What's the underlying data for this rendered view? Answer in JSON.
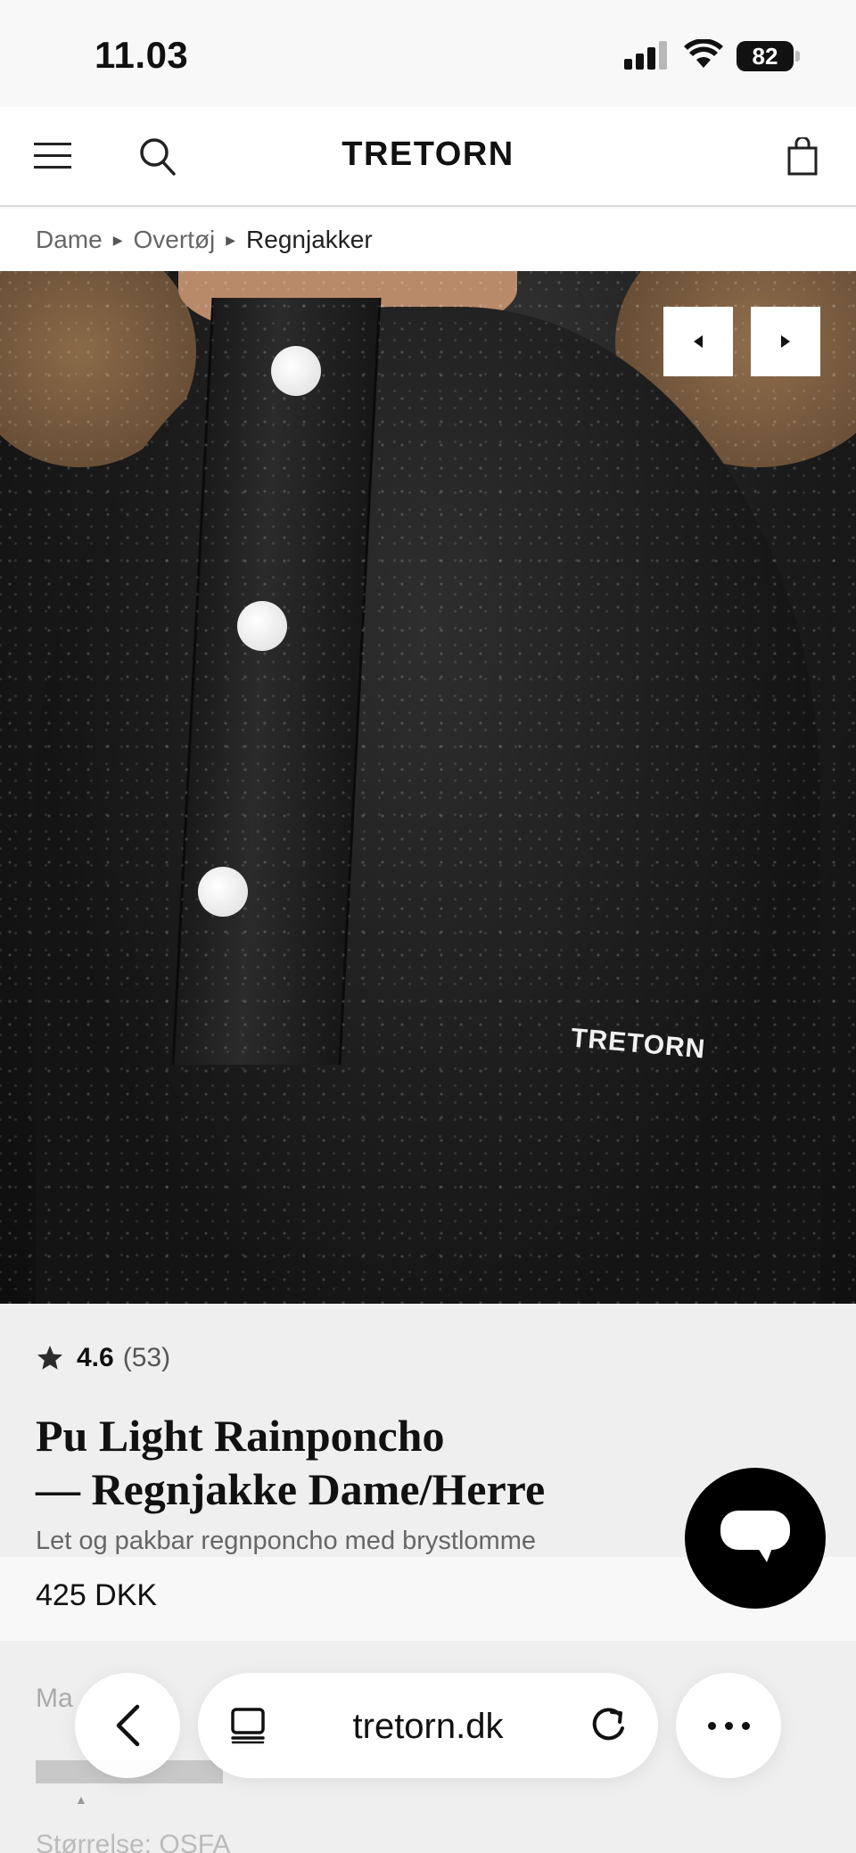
{
  "status_bar": {
    "time": "11.03",
    "battery": "82"
  },
  "header": {
    "logo": "TRETORN"
  },
  "breadcrumb": [
    "Dame",
    "Overtøj",
    "Regnjakker"
  ],
  "hero": {
    "print_logo": "TRETORN"
  },
  "product": {
    "rating_value": "4.6",
    "rating_count": "(53)",
    "title_line1": "Pu Light Rainponcho",
    "title_line2": "— Regnjakke Dame/Herre",
    "subtitle": "Let og pakbar regnponcho med brystlomme",
    "price": "425 DKK",
    "color_label": "Ma",
    "size_label": "Størrelse: OSFA"
  },
  "browser": {
    "url": "tretorn.dk"
  },
  "colors": {
    "accent": "#000000",
    "background": "#efefef"
  },
  "icons": [
    "menu-icon",
    "search-icon",
    "bag-icon",
    "star-icon",
    "chat-icon",
    "back-icon",
    "tabs-icon",
    "reload-icon",
    "more-icon"
  ]
}
